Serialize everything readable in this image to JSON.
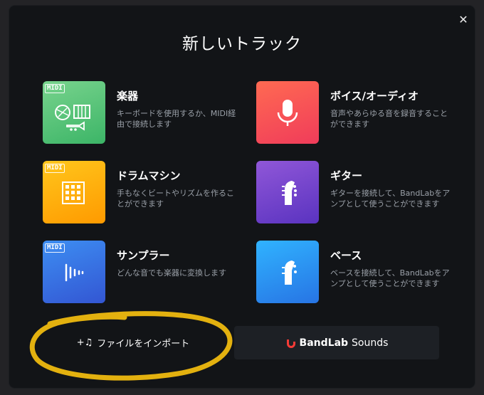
{
  "dialog": {
    "title": "新しいトラック",
    "close_glyph": "✕"
  },
  "tiles": [
    {
      "label": "楽器",
      "desc": "キーボードを使用するか、MIDI経由で接続します",
      "badge": "MIDI",
      "icon": "instruments-icon",
      "colors": [
        "#71d18b",
        "#3fb86a"
      ]
    },
    {
      "label": "ボイス/オーディオ",
      "desc": "音声やあらゆる音を録音することができます",
      "badge": "",
      "icon": "microphone-icon",
      "colors": [
        "#ff5a5a",
        "#f04156"
      ]
    },
    {
      "label": "ドラムマシン",
      "desc": "手もなくビートやリズムを作ることができます",
      "badge": "MIDI",
      "icon": "drum-pad-icon",
      "colors": [
        "#ffc21a",
        "#ff9b00"
      ]
    },
    {
      "label": "ギター",
      "desc": "ギターを接続して、BandLabをアンプとして使うことができます",
      "badge": "",
      "icon": "guitar-headstock-icon",
      "colors": [
        "#8d56d6",
        "#5d35c2"
      ]
    },
    {
      "label": "サンプラー",
      "desc": "どんな音でも楽器に変換します",
      "badge": "MIDI",
      "icon": "waveform-icon",
      "colors": [
        "#3a8df2",
        "#3457d5"
      ]
    },
    {
      "label": "ベース",
      "desc": "ベースを接続して、BandLabをアンプとして使うことができます",
      "badge": "",
      "icon": "bass-headstock-icon",
      "colors": [
        "#2fb0ff",
        "#2877e6"
      ]
    }
  ],
  "bottom": {
    "import_prefix": "+♫",
    "import_label": "ファイルをインポート",
    "sounds_brand": "BandLab",
    "sounds_label": "Sounds",
    "brand_color": "#f53b36"
  }
}
